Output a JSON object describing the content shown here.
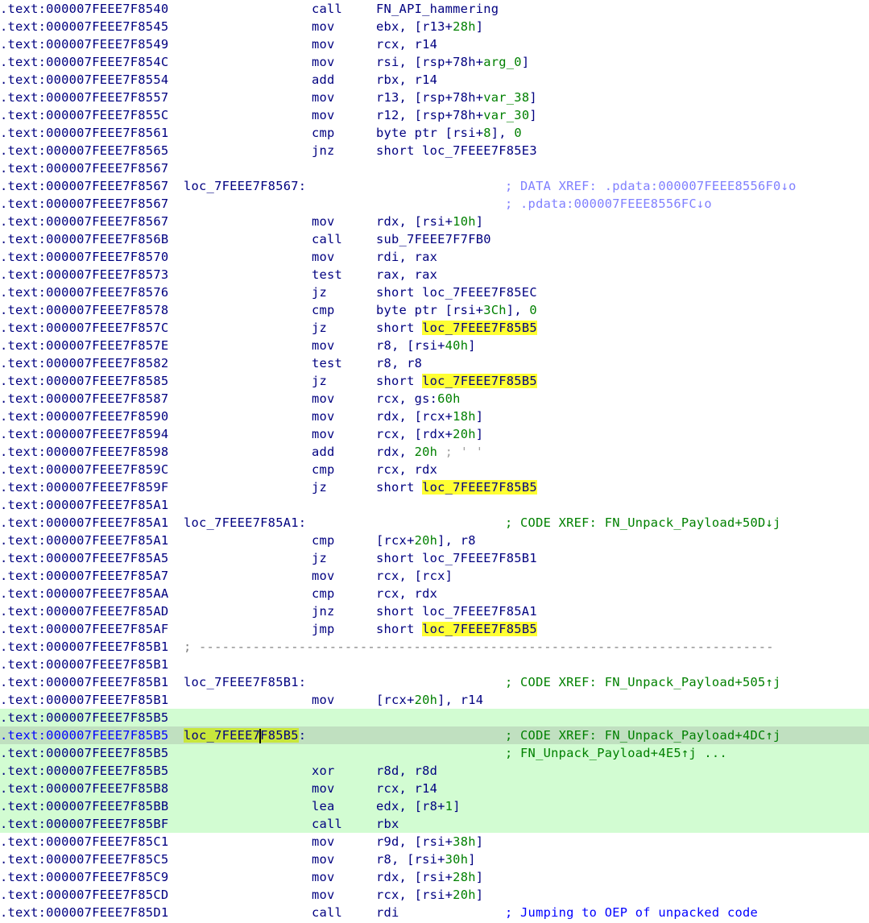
{
  "app": "IDA disassembly listing",
  "colors": {
    "address": "#000080",
    "current_address": "#0000ff",
    "immediate_number": "#008000",
    "data_xref_comment": "#8080ff",
    "code_xref_comment": "#008000",
    "user_comment": "#0000ff",
    "search_highlight": "#ffff33",
    "block_highlight": "#d2fcd2",
    "current_line": "#c0e0c0"
  },
  "highlighted_identifier": "loc_7FEEE7F85B5",
  "lines": [
    {
      "addr": ".text:000007FEEE7F8540",
      "mnem": "call",
      "ops": [
        {
          "t": "FN_API_hammering"
        }
      ]
    },
    {
      "addr": ".text:000007FEEE7F8545",
      "mnem": "mov",
      "ops": [
        {
          "t": "ebx, [r13+"
        },
        {
          "t": "28h",
          "k": "num"
        },
        {
          "t": "]"
        }
      ]
    },
    {
      "addr": ".text:000007FEEE7F8549",
      "mnem": "mov",
      "ops": [
        {
          "t": "rcx, r14"
        }
      ]
    },
    {
      "addr": ".text:000007FEEE7F854C",
      "mnem": "mov",
      "ops": [
        {
          "t": "rsi, [rsp+78h+"
        },
        {
          "t": "arg_0",
          "k": "num"
        },
        {
          "t": "]"
        }
      ]
    },
    {
      "addr": ".text:000007FEEE7F8554",
      "mnem": "add",
      "ops": [
        {
          "t": "rbx, r14"
        }
      ]
    },
    {
      "addr": ".text:000007FEEE7F8557",
      "mnem": "mov",
      "ops": [
        {
          "t": "r13, [rsp+78h+"
        },
        {
          "t": "var_38",
          "k": "num"
        },
        {
          "t": "]"
        }
      ]
    },
    {
      "addr": ".text:000007FEEE7F855C",
      "mnem": "mov",
      "ops": [
        {
          "t": "r12, [rsp+78h+"
        },
        {
          "t": "var_30",
          "k": "num"
        },
        {
          "t": "]"
        }
      ]
    },
    {
      "addr": ".text:000007FEEE7F8561",
      "mnem": "cmp",
      "ops": [
        {
          "t": "byte ptr [rsi+"
        },
        {
          "t": "8",
          "k": "num"
        },
        {
          "t": "], "
        },
        {
          "t": "0",
          "k": "num"
        }
      ]
    },
    {
      "addr": ".text:000007FEEE7F8565",
      "mnem": "jnz",
      "ops": [
        {
          "t": "short loc_7FEEE7F85E3"
        }
      ]
    },
    {
      "addr": ".text:000007FEEE7F8567"
    },
    {
      "addr": ".text:000007FEEE7F8567",
      "label": "loc_7FEEE7F8567:",
      "cmt": "; DATA XREF: .pdata:000007FEEE8556F0↓o",
      "cmt_kind": "data"
    },
    {
      "addr": ".text:000007FEEE7F8567",
      "cmt": "; .pdata:000007FEEE8556FC↓o",
      "cmt_kind": "data"
    },
    {
      "addr": ".text:000007FEEE7F8567",
      "mnem": "mov",
      "ops": [
        {
          "t": "rdx, [rsi+"
        },
        {
          "t": "10h",
          "k": "num"
        },
        {
          "t": "]"
        }
      ]
    },
    {
      "addr": ".text:000007FEEE7F856B",
      "mnem": "call",
      "ops": [
        {
          "t": "sub_7FEEE7F7FB0"
        }
      ]
    },
    {
      "addr": ".text:000007FEEE7F8570",
      "mnem": "mov",
      "ops": [
        {
          "t": "rdi, rax"
        }
      ]
    },
    {
      "addr": ".text:000007FEEE7F8573",
      "mnem": "test",
      "ops": [
        {
          "t": "rax, rax"
        }
      ]
    },
    {
      "addr": ".text:000007FEEE7F8576",
      "mnem": "jz",
      "ops": [
        {
          "t": "short loc_7FEEE7F85EC"
        }
      ]
    },
    {
      "addr": ".text:000007FEEE7F8578",
      "mnem": "cmp",
      "ops": [
        {
          "t": "byte ptr [rsi+"
        },
        {
          "t": "3Ch",
          "k": "num"
        },
        {
          "t": "], "
        },
        {
          "t": "0",
          "k": "num"
        }
      ]
    },
    {
      "addr": ".text:000007FEEE7F857C",
      "mnem": "jz",
      "ops": [
        {
          "t": "short "
        },
        {
          "t": "loc_7FEEE7F85B5",
          "k": "yhl"
        }
      ]
    },
    {
      "addr": ".text:000007FEEE7F857E",
      "mnem": "mov",
      "ops": [
        {
          "t": "r8, [rsi+"
        },
        {
          "t": "40h",
          "k": "num"
        },
        {
          "t": "]"
        }
      ]
    },
    {
      "addr": ".text:000007FEEE7F8582",
      "mnem": "test",
      "ops": [
        {
          "t": "r8, r8"
        }
      ]
    },
    {
      "addr": ".text:000007FEEE7F8585",
      "mnem": "jz",
      "ops": [
        {
          "t": "short "
        },
        {
          "t": "loc_7FEEE7F85B5",
          "k": "yhl"
        }
      ]
    },
    {
      "addr": ".text:000007FEEE7F8587",
      "mnem": "mov",
      "ops": [
        {
          "t": "rcx, gs:"
        },
        {
          "t": "60h",
          "k": "num"
        }
      ]
    },
    {
      "addr": ".text:000007FEEE7F8590",
      "mnem": "mov",
      "ops": [
        {
          "t": "rdx, [rcx+"
        },
        {
          "t": "18h",
          "k": "num"
        },
        {
          "t": "]"
        }
      ]
    },
    {
      "addr": ".text:000007FEEE7F8594",
      "mnem": "mov",
      "ops": [
        {
          "t": "rcx, [rdx+"
        },
        {
          "t": "20h",
          "k": "num"
        },
        {
          "t": "]"
        }
      ]
    },
    {
      "addr": ".text:000007FEEE7F8598",
      "mnem": "add",
      "ops": [
        {
          "t": "rdx, "
        },
        {
          "t": "20h",
          "k": "num"
        },
        {
          "t": " ; ' '",
          "k": "strc"
        }
      ]
    },
    {
      "addr": ".text:000007FEEE7F859C",
      "mnem": "cmp",
      "ops": [
        {
          "t": "rcx, rdx"
        }
      ]
    },
    {
      "addr": ".text:000007FEEE7F859F",
      "mnem": "jz",
      "ops": [
        {
          "t": "short "
        },
        {
          "t": "loc_7FEEE7F85B5",
          "k": "yhl"
        }
      ]
    },
    {
      "addr": ".text:000007FEEE7F85A1"
    },
    {
      "addr": ".text:000007FEEE7F85A1",
      "label": "loc_7FEEE7F85A1:",
      "cmt": "; CODE XREF: FN_Unpack_Payload+50D↓j",
      "cmt_kind": "code"
    },
    {
      "addr": ".text:000007FEEE7F85A1",
      "mnem": "cmp",
      "ops": [
        {
          "t": "[rcx+"
        },
        {
          "t": "20h",
          "k": "num"
        },
        {
          "t": "], r8"
        }
      ]
    },
    {
      "addr": ".text:000007FEEE7F85A5",
      "mnem": "jz",
      "ops": [
        {
          "t": "short loc_7FEEE7F85B1"
        }
      ]
    },
    {
      "addr": ".text:000007FEEE7F85A7",
      "mnem": "mov",
      "ops": [
        {
          "t": "rcx, [rcx]"
        }
      ]
    },
    {
      "addr": ".text:000007FEEE7F85AA",
      "mnem": "cmp",
      "ops": [
        {
          "t": "rcx, rdx"
        }
      ]
    },
    {
      "addr": ".text:000007FEEE7F85AD",
      "mnem": "jnz",
      "ops": [
        {
          "t": "short loc_7FEEE7F85A1"
        }
      ]
    },
    {
      "addr": ".text:000007FEEE7F85AF",
      "mnem": "jmp",
      "ops": [
        {
          "t": "short "
        },
        {
          "t": "loc_7FEEE7F85B5",
          "k": "yhl"
        }
      ]
    },
    {
      "addr": ".text:000007FEEE7F85B1",
      "sep": "; ---------------------------------------------------------------------------"
    },
    {
      "addr": ".text:000007FEEE7F85B1"
    },
    {
      "addr": ".text:000007FEEE7F85B1",
      "label": "loc_7FEEE7F85B1:",
      "cmt": "; CODE XREF: FN_Unpack_Payload+505↑j",
      "cmt_kind": "code"
    },
    {
      "addr": ".text:000007FEEE7F85B1",
      "mnem": "mov",
      "ops": [
        {
          "t": "[rcx+"
        },
        {
          "t": "20h",
          "k": "num"
        },
        {
          "t": "], r14"
        }
      ]
    },
    {
      "addr": ".text:000007FEEE7F85B5",
      "hl": true
    },
    {
      "addr": ".text:000007FEEE7F85B5",
      "hl": true,
      "current": true,
      "label_parts": [
        "loc_7FEEE7",
        "F85B5"
      ],
      "label_suffix": ":",
      "cmt": "; CODE XREF: FN_Unpack_Payload+4DC↑j",
      "cmt_kind": "code"
    },
    {
      "addr": ".text:000007FEEE7F85B5",
      "hl": true,
      "cmt": "; FN_Unpack_Payload+4E5↑j ...",
      "cmt_kind": "code"
    },
    {
      "addr": ".text:000007FEEE7F85B5",
      "hl": true,
      "mnem": "xor",
      "ops": [
        {
          "t": "r8d, r8d"
        }
      ]
    },
    {
      "addr": ".text:000007FEEE7F85B8",
      "hl": true,
      "mnem": "mov",
      "ops": [
        {
          "t": "rcx, r14"
        }
      ]
    },
    {
      "addr": ".text:000007FEEE7F85BB",
      "hl": true,
      "mnem": "lea",
      "ops": [
        {
          "t": "edx, [r8+"
        },
        {
          "t": "1",
          "k": "num"
        },
        {
          "t": "]"
        }
      ]
    },
    {
      "addr": ".text:000007FEEE7F85BF",
      "hl": true,
      "mnem": "call",
      "ops": [
        {
          "t": "rbx"
        }
      ]
    },
    {
      "addr": ".text:000007FEEE7F85C1",
      "mnem": "mov",
      "ops": [
        {
          "t": "r9d, [rsi+"
        },
        {
          "t": "38h",
          "k": "num"
        },
        {
          "t": "]"
        }
      ]
    },
    {
      "addr": ".text:000007FEEE7F85C5",
      "mnem": "mov",
      "ops": [
        {
          "t": "r8, [rsi+"
        },
        {
          "t": "30h",
          "k": "num"
        },
        {
          "t": "]"
        }
      ]
    },
    {
      "addr": ".text:000007FEEE7F85C9",
      "mnem": "mov",
      "ops": [
        {
          "t": "rdx, [rsi+"
        },
        {
          "t": "28h",
          "k": "num"
        },
        {
          "t": "]"
        }
      ]
    },
    {
      "addr": ".text:000007FEEE7F85CD",
      "mnem": "mov",
      "ops": [
        {
          "t": "rcx, [rsi+"
        },
        {
          "t": "20h",
          "k": "num"
        },
        {
          "t": "]"
        }
      ]
    },
    {
      "addr": ".text:000007FEEE7F85D1",
      "mnem": "call",
      "ops": [
        {
          "t": "rdi"
        }
      ],
      "cmt": "; Jumping to OEP of unpacked code",
      "cmt_kind": "user"
    }
  ]
}
